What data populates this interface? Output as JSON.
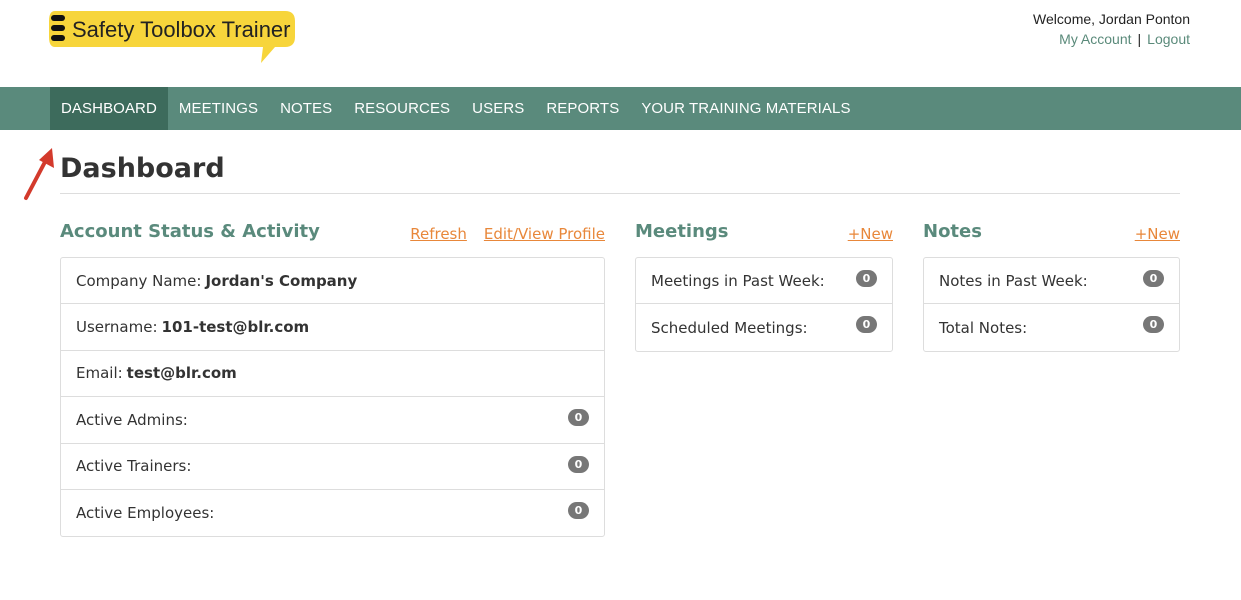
{
  "header": {
    "logo_text": "Safety Toolbox Trainer",
    "welcome": "Welcome, Jordan Ponton",
    "my_account": "My Account",
    "separator": "|",
    "logout": "Logout"
  },
  "nav": {
    "items": [
      {
        "label": "DASHBOARD",
        "active": true
      },
      {
        "label": "MEETINGS"
      },
      {
        "label": "NOTES"
      },
      {
        "label": "RESOURCES"
      },
      {
        "label": "USERS"
      },
      {
        "label": "REPORTS"
      },
      {
        "label": "YOUR TRAINING MATERIALS"
      }
    ]
  },
  "page": {
    "title": "Dashboard"
  },
  "account": {
    "title": "Account Status & Activity",
    "refresh": "Refresh",
    "edit_profile": "Edit/View Profile",
    "company_label": "Company Name:",
    "company_value": "Jordan's Company",
    "username_label": "Username:",
    "username_value": "101-test@blr.com",
    "email_label": "Email:",
    "email_value": "test@blr.com",
    "admins_label": "Active Admins:",
    "admins_count": "0",
    "trainers_label": "Active Trainers:",
    "trainers_count": "0",
    "employees_label": "Active Employees:",
    "employees_count": "0"
  },
  "meetings": {
    "title": "Meetings",
    "new": "+New",
    "past_week_label": "Meetings in Past Week:",
    "past_week_count": "0",
    "scheduled_label": "Scheduled Meetings:",
    "scheduled_count": "0"
  },
  "notes": {
    "title": "Notes",
    "new": "+New",
    "past_week_label": "Notes in Past Week:",
    "past_week_count": "0",
    "total_label": "Total Notes:",
    "total_count": "0"
  },
  "colors": {
    "nav_bg": "#5a8a7c",
    "nav_active": "#3d6b5c",
    "accent_link": "#e8873a",
    "logo_yellow": "#f7d53b",
    "badge": "#777777"
  }
}
